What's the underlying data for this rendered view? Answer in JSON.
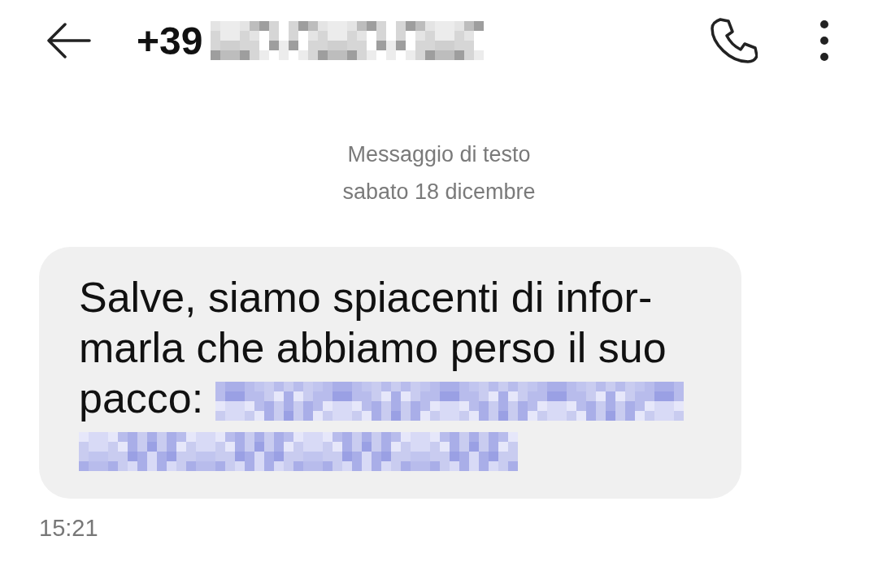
{
  "header": {
    "title": "+39",
    "number_redacted": true
  },
  "thread_info": {
    "label": "Messaggio di testo",
    "date": "sabato 18 dicembre"
  },
  "messages": [
    {
      "kind": "incoming",
      "text": "Salve, siamo spiacenti di infor-marla che abbiamo perso il suo pacco:",
      "link_redacted": true,
      "time": "15:21"
    }
  ]
}
